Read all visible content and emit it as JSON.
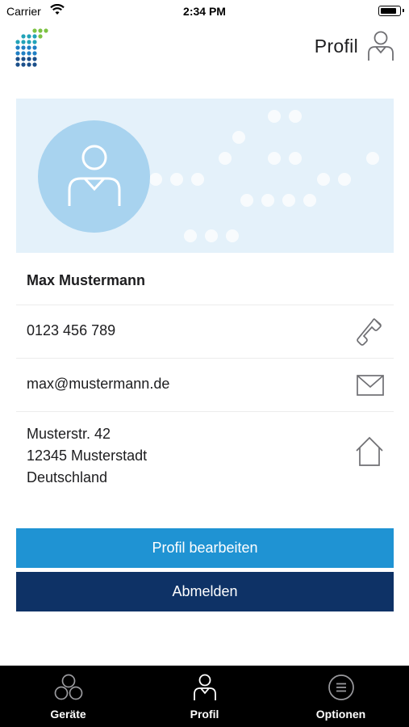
{
  "status_bar": {
    "carrier": "Carrier",
    "time": "2:34 PM"
  },
  "header": {
    "title": "Profil",
    "icon": "person-icon"
  },
  "profile": {
    "name": "Max Mustermann",
    "phone": "0123 456 789",
    "email": "max@mustermann.de",
    "address": {
      "line1": "Musterstr. 42",
      "line2": "12345 Musterstadt",
      "line3": "Deutschland"
    }
  },
  "buttons": {
    "edit": "Profil bearbeiten",
    "logout": "Abmelden"
  },
  "tab_bar": {
    "items": [
      {
        "label": "Geräte",
        "icon": "devices-icon"
      },
      {
        "label": "Profil",
        "icon": "person-icon"
      },
      {
        "label": "Optionen",
        "icon": "menu-circle-icon"
      }
    ]
  },
  "colors": {
    "primary_blue": "#1f93d3",
    "dark_navy": "#0e3266",
    "hero_background": "#e4f1fa",
    "avatar_background": "#a8d3ef"
  }
}
